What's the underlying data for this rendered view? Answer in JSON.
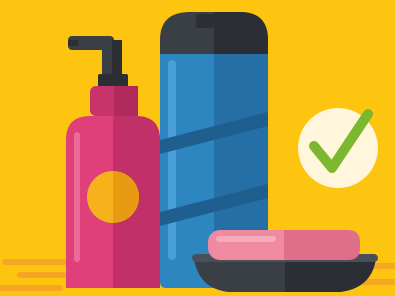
{
  "illustration": {
    "subject": "hygiene-products",
    "items": [
      {
        "kind": "pump-bottle",
        "icon": "pump-bottle-icon",
        "body_color": "#E0407A",
        "pump_color": "#3A3F45",
        "label_color": "#F6B21A"
      },
      {
        "kind": "shampoo-bottle",
        "icon": "shampoo-bottle-icon",
        "body_color": "#2E86C1",
        "cap_color": "#3A3F45"
      },
      {
        "kind": "soap-bar",
        "icon": "soap-bar-icon",
        "color": "#F08AA0"
      },
      {
        "kind": "soap-dish",
        "icon": "soap-dish-icon",
        "color": "#3A3F45"
      },
      {
        "kind": "check-badge",
        "icon": "check-mark-icon",
        "badge_color": "#FFF6DC",
        "check_color": "#7CB82F"
      }
    ]
  },
  "colors": {
    "background": "#FDC50F",
    "floor_accent": "#F5A623"
  }
}
